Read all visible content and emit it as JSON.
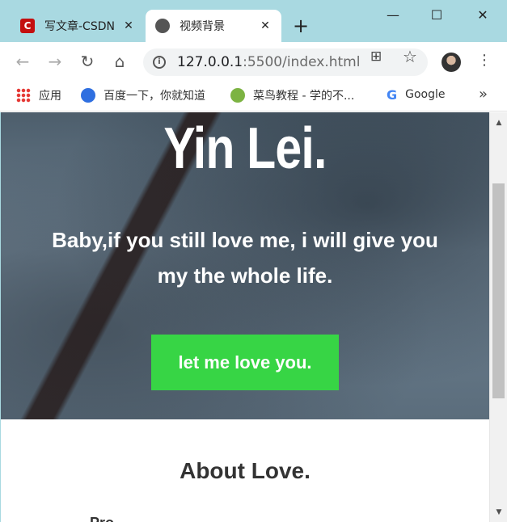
{
  "tabs": [
    {
      "title": "写文章-CSDN",
      "favicon": "csdn-icon",
      "close": "✕"
    },
    {
      "title": "视频背景",
      "favicon": "globe-icon",
      "close": "✕"
    }
  ],
  "window": {
    "new_tab": "+",
    "minimize": "—",
    "maximize": "☐",
    "close": "✕"
  },
  "toolbar": {
    "back": "←",
    "forward": "→",
    "reload": "↻",
    "home": "⌂",
    "url_host": "127.0.0.1",
    "url_rest": ":5500/index.html",
    "translate": "⊞",
    "star": "☆",
    "menu": "⋮"
  },
  "bookmarks": {
    "items": [
      {
        "label": "应用",
        "icon": "apps-icon"
      },
      {
        "label": "百度一下，你就知道",
        "icon": "baidu-icon"
      },
      {
        "label": "菜鸟教程 - 学的不...",
        "icon": "runoob-icon"
      },
      {
        "label": "Google",
        "icon": "google-icon"
      }
    ],
    "more": "»"
  },
  "page": {
    "hero_title": "Yin Lei.",
    "hero_subtitle": "Baby,if you still love me, i will give you my the whole life.",
    "cta_label": "let me love you.",
    "section_title": "About Love.",
    "section_peek": "Pro       ...    ..."
  },
  "colors": {
    "tab_bar": "#a9d9e1",
    "cta": "#37d545"
  },
  "scrollbar": {
    "up": "▲",
    "down": "▼"
  }
}
